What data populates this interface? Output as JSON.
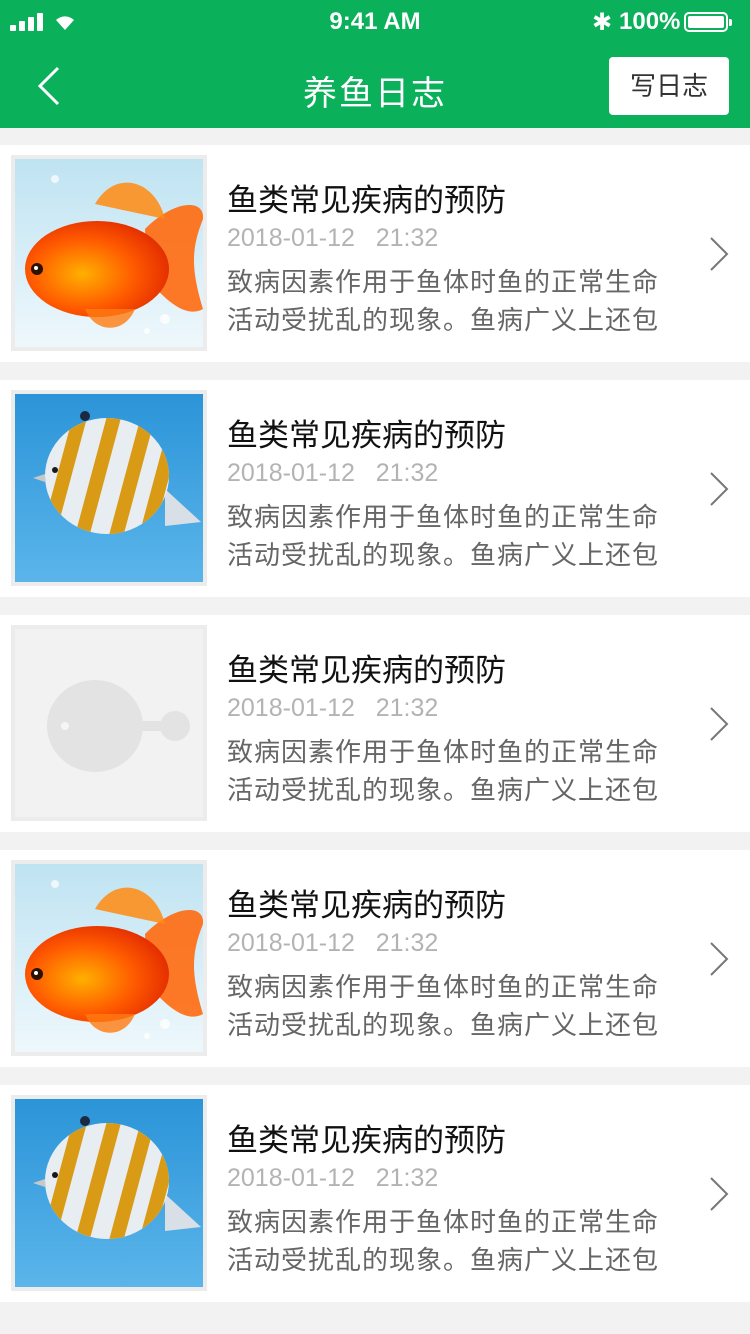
{
  "status_bar": {
    "time": "9:41 AM",
    "battery": "100%"
  },
  "header": {
    "title": "养鱼日志",
    "write_label": "写日志"
  },
  "articles": [
    {
      "title": "鱼类常见疾病的预防",
      "date": "2018-01-12   21:32",
      "summary": "致病因素作用于鱼体时鱼的正常生命活动受扰乱的现象。鱼病广义上还包",
      "image": "goldfish"
    },
    {
      "title": "鱼类常见疾病的预防",
      "date": "2018-01-12   21:32",
      "summary": "致病因素作用于鱼体时鱼的正常生命活动受扰乱的现象。鱼病广义上还包",
      "image": "butterflyfish"
    },
    {
      "title": "鱼类常见疾病的预防",
      "date": "2018-01-12   21:32",
      "summary": "致病因素作用于鱼体时鱼的正常生命活动受扰乱的现象。鱼病广义上还包",
      "image": "placeholder"
    },
    {
      "title": "鱼类常见疾病的预防",
      "date": "2018-01-12   21:32",
      "summary": "致病因素作用于鱼体时鱼的正常生命活动受扰乱的现象。鱼病广义上还包",
      "image": "goldfish"
    },
    {
      "title": "鱼类常见疾病的预防",
      "date": "2018-01-12   21:32",
      "summary": "致病因素作用于鱼体时鱼的正常生命活动受扰乱的现象。鱼病广义上还包",
      "image": "butterflyfish"
    }
  ],
  "colors": {
    "brand_green": "#0ab05a",
    "page_bg": "#f2f2f2"
  }
}
